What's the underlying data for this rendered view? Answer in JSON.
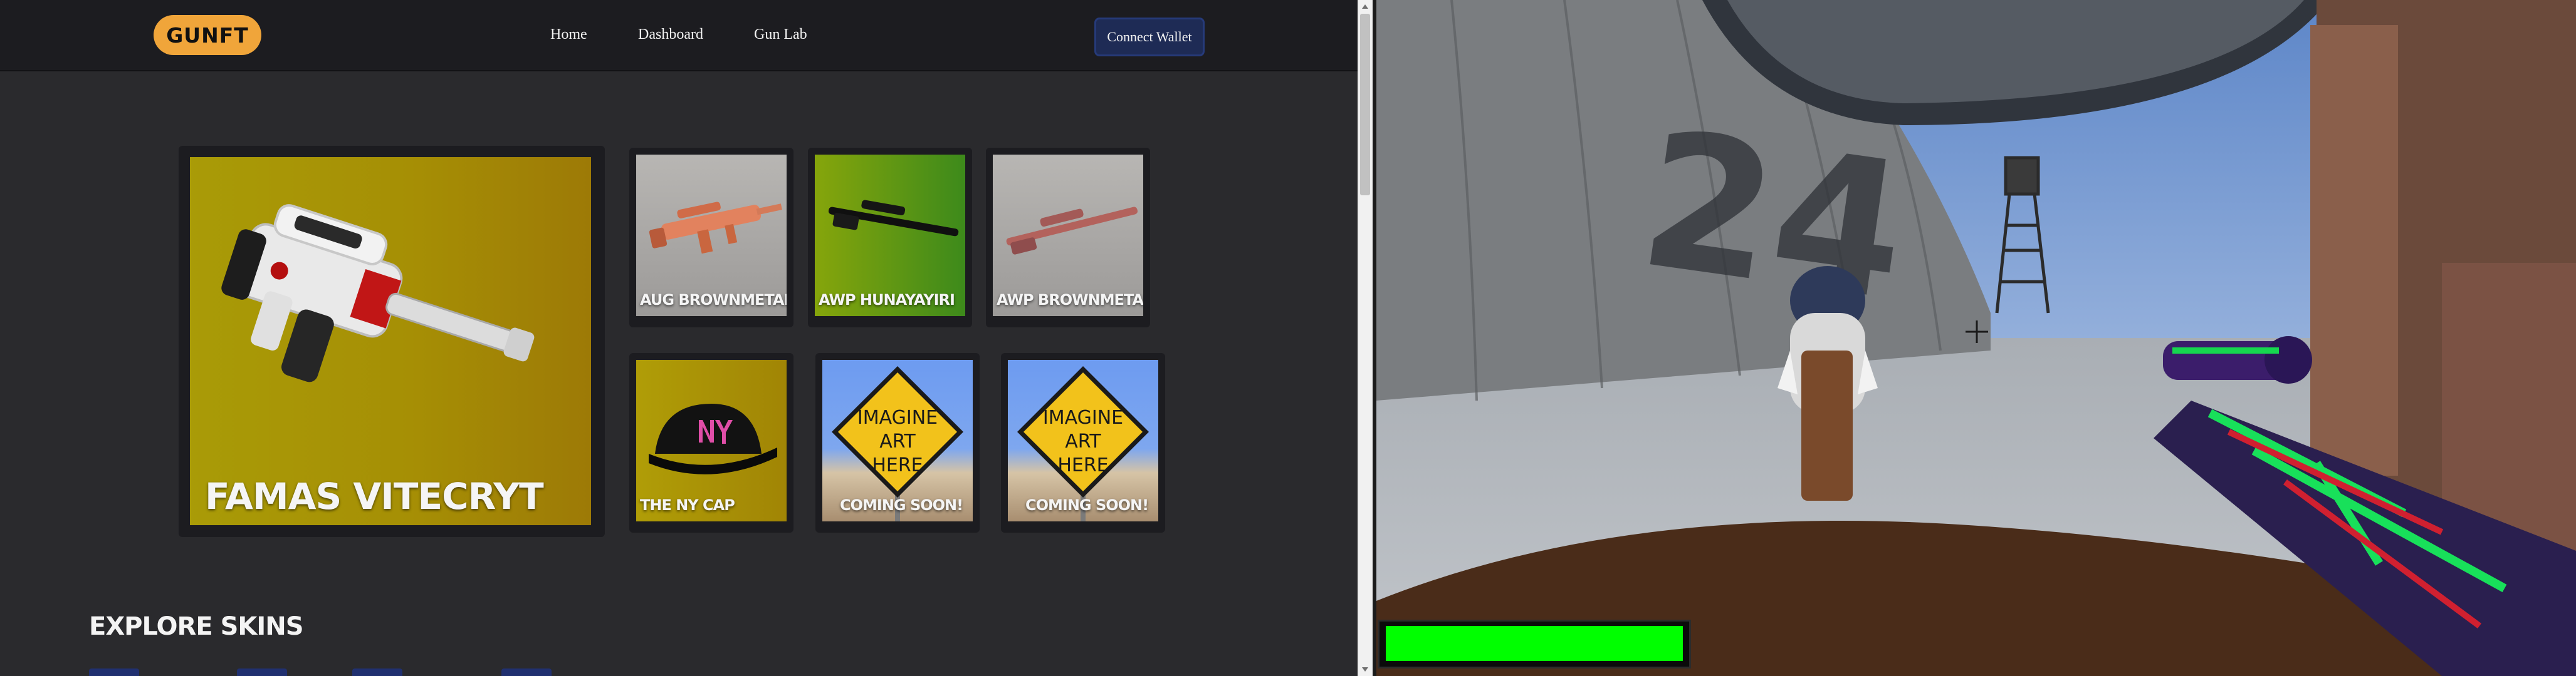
{
  "site": {
    "logo": "GUNFT",
    "nav": {
      "home": "Home",
      "dashboard": "Dashboard",
      "gun_lab": "Gun Lab"
    },
    "connect_wallet": "Connect Wallet",
    "featured": {
      "title": "FAMAS VITECRYT"
    },
    "grid": [
      {
        "title": "AUG BROWNMETAL"
      },
      {
        "title": "AWP HUNAYAYIRI"
      },
      {
        "title": "AWP BROWNMETAL"
      },
      {
        "title": "THE NY CAP"
      },
      {
        "title": "COMING SOON!",
        "sign_text": "IMAGINE ART HERE"
      },
      {
        "title": "COMING SOON!",
        "sign_text": "IMAGINE ART HERE"
      }
    ],
    "section_heading": "EXPLORE SKINS"
  },
  "game": {
    "hud": {
      "health_fraction": 1.0
    },
    "colors": {
      "health": "#00ff00",
      "sky": "#8aa9d6"
    },
    "world_text": "24"
  },
  "icons": {
    "crosshair": "crosshair-icon",
    "scroll_up": "chevron-up-icon",
    "scroll_down": "chevron-down-icon"
  }
}
